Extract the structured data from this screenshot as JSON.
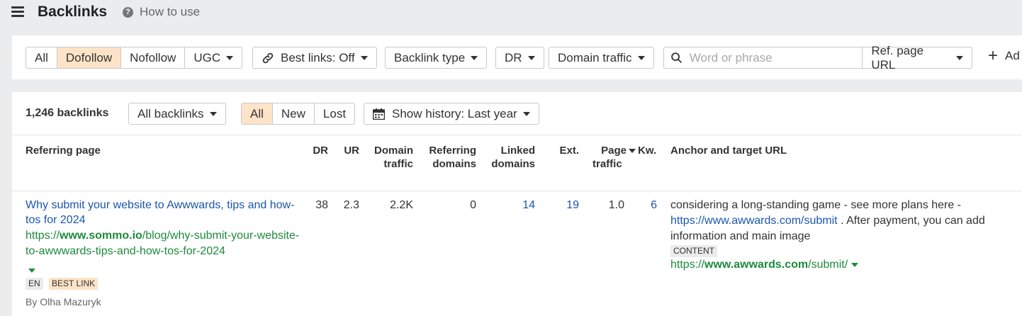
{
  "header": {
    "title": "Backlinks",
    "how_to_use": "How to use"
  },
  "filters": {
    "link_types": [
      "All",
      "Dofollow",
      "Nofollow",
      "UGC"
    ],
    "link_types_active": "Dofollow",
    "best_links": "Best links: Off",
    "backlink_type": "Backlink type",
    "dr": "DR",
    "domain_traffic": "Domain traffic",
    "search_placeholder": "Word or phrase",
    "search_value": "",
    "search_scope": "Ref. page URL",
    "add_filter": "Ad"
  },
  "summary": {
    "count": "1,246 backlinks",
    "grouping": "All backlinks",
    "status_tabs": [
      "All",
      "New",
      "Lost"
    ],
    "status_active": "All",
    "history": "Show history: Last year"
  },
  "table": {
    "headers": {
      "referring_page": "Referring page",
      "dr": "DR",
      "ur": "UR",
      "domain_traffic": [
        "Domain",
        "traffic"
      ],
      "referring_domains": [
        "Referring",
        "domains"
      ],
      "linked_domains": [
        "Linked",
        "domains"
      ],
      "ext": "Ext.",
      "page_traffic": [
        "Page",
        "traffic"
      ],
      "kw": "Kw.",
      "anchor": "Anchor and target URL"
    },
    "rows": [
      {
        "title": "Why submit your website to Awwwards, tips and how-tos for 2024",
        "url_prefix": "https://",
        "url_domain": "www.sommo.io",
        "url_path": "/blog/why-submit-your-website-to-awwwards-tips-and-how-tos-for-2024",
        "tags": [
          "EN",
          "BEST LINK"
        ],
        "author": "By Olha Mazuryk",
        "dr": "38",
        "ur": "2.3",
        "domain_traffic": "2.2K",
        "referring_domains": "0",
        "linked_domains": "14",
        "ext": "19",
        "page_traffic": "1.0",
        "kw": "6",
        "anchor_before": "considering a long-standing game - see more plans here - ",
        "anchor_link": "https://www.awwards.com/submit",
        "anchor_after": " . After payment, you can add information and main image",
        "anchor_tag": "CONTENT",
        "target_prefix": "https://",
        "target_domain": "www.awwards.com",
        "target_path": "/submit/"
      }
    ]
  },
  "colors": {
    "active_segment": "#fde3c7",
    "link_blue": "#1b57b0",
    "url_green": "#1c8a3c"
  }
}
